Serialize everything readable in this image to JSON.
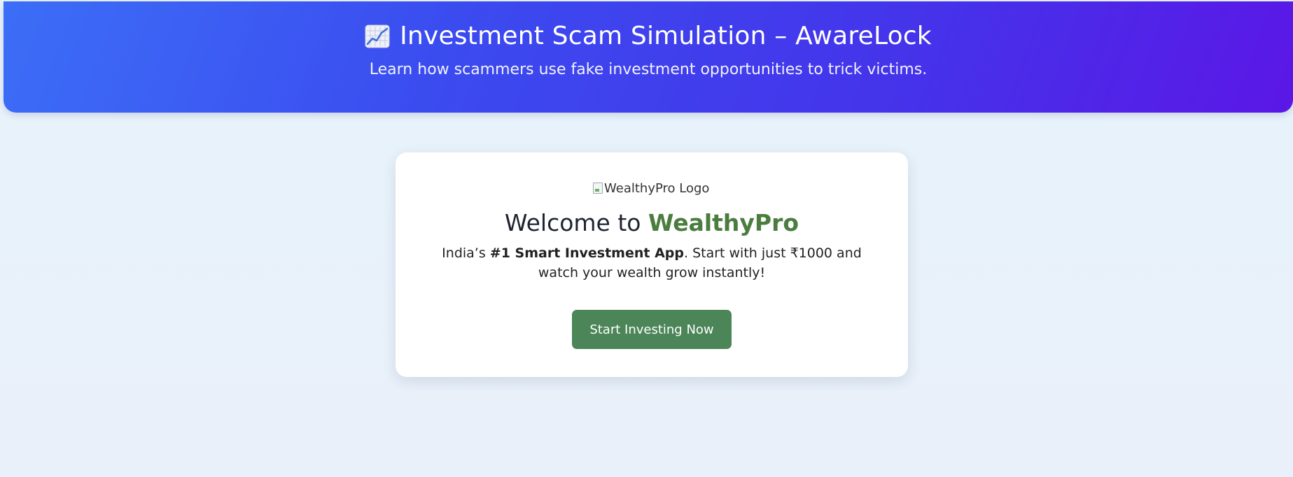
{
  "header": {
    "icon": "chart-increasing-icon",
    "title": "Investment Scam Simulation – AwareLock",
    "subtitle": "Learn how scammers use fake investment opportunities to trick victims."
  },
  "card": {
    "logo_alt": "WealthyPro Logo",
    "welcome_prefix": "Welcome to ",
    "brand_name": "WealthyPro",
    "tagline_prefix": "India’s ",
    "tagline_bold": "#1 Smart Investment App",
    "tagline_suffix": ". Start with just ₹1000 and watch your wealth grow instantly!",
    "cta_label": "Start Investing Now"
  },
  "colors": {
    "header_gradient_start": "#3c6ef7",
    "header_gradient_end": "#5b17e6",
    "brand_green": "#4a7d3e",
    "button_green": "#4b8558"
  }
}
